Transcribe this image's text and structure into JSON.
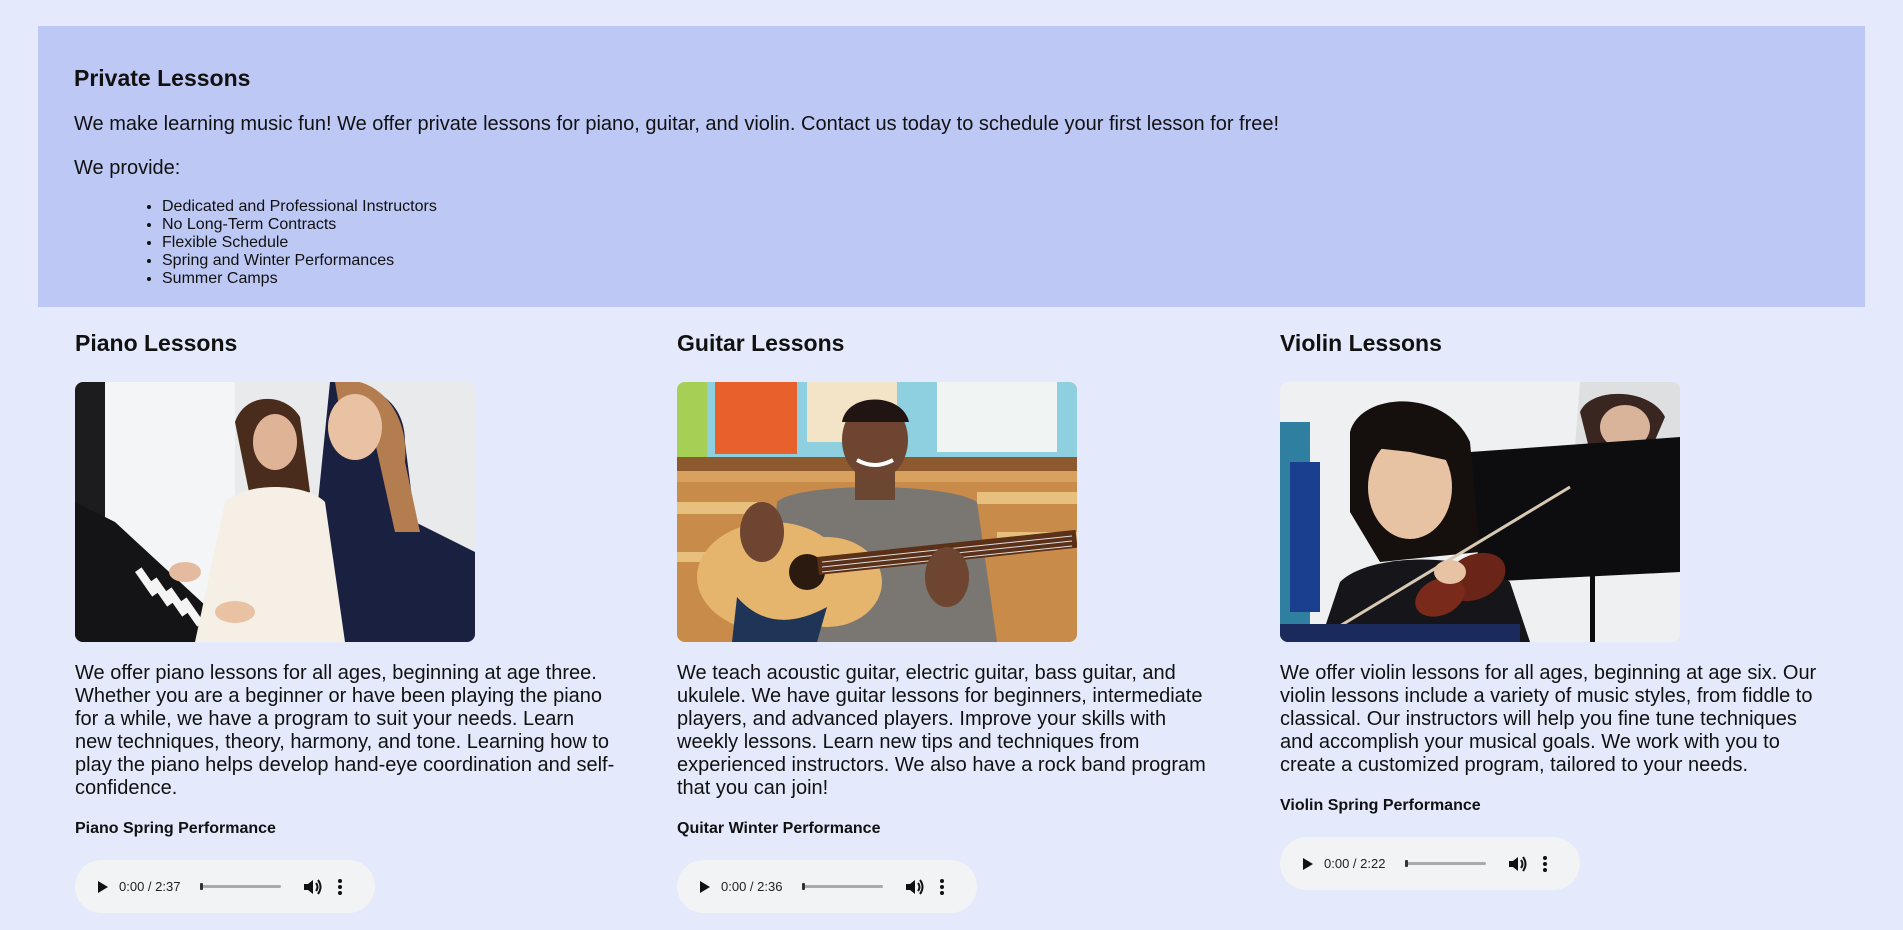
{
  "intro": {
    "title": "Private Lessons",
    "lead": "We make learning music fun! We offer private lessons for piano, guitar, and violin. Contact us today to schedule your first lesson for free!",
    "provide_label": "We provide:",
    "benefits": [
      "Dedicated and Professional Instructors",
      "No Long-Term Contracts",
      "Flexible Schedule",
      "Spring and Winter Performances",
      "Summer Camps"
    ]
  },
  "lessons": [
    {
      "title": "Piano Lessons",
      "description": "We offer piano lessons for all ages, beginning at age three. Whether you are a beginner or have been playing the piano for a while, we have a program to suit your needs. Learn new techniques, theory, harmony, and tone. Learning how to play the piano helps develop hand-eye coordination and self-confidence.",
      "performance": "Piano Spring Performance",
      "audio_time": "0:00 / 2:37",
      "audio_progress": 0
    },
    {
      "title": "Guitar Lessons",
      "description": "We teach acoustic guitar, electric guitar, bass guitar, and ukulele. We have guitar lessons for beginners, intermediate players, and advanced players. Improve your skills with weekly lessons. Learn new tips and techniques from experienced instructors. We also have a rock band program that you can join!",
      "performance": "Quitar Winter Performance",
      "audio_time": "0:00 / 2:36",
      "audio_progress": 0
    },
    {
      "title": "Violin Lessons",
      "description": "We offer violin lessons for all ages, beginning at age six. Our violin lessons include a variety of music styles, from fiddle to classical. Our instructors will help you fine tune techniques and accomplish your musical goals. We work with you to create a customized program, tailored to your needs.",
      "performance": "Violin Spring Performance",
      "audio_time": "0:00 / 2:22",
      "audio_progress": 0
    }
  ],
  "icons": {
    "play": "play-icon",
    "volume": "volume-icon",
    "more": "more-vert-icon"
  },
  "colors": {
    "page_background": "#e4e9fb",
    "intro_background": "#bdc8f5",
    "player_background": "#f1f3f4"
  }
}
